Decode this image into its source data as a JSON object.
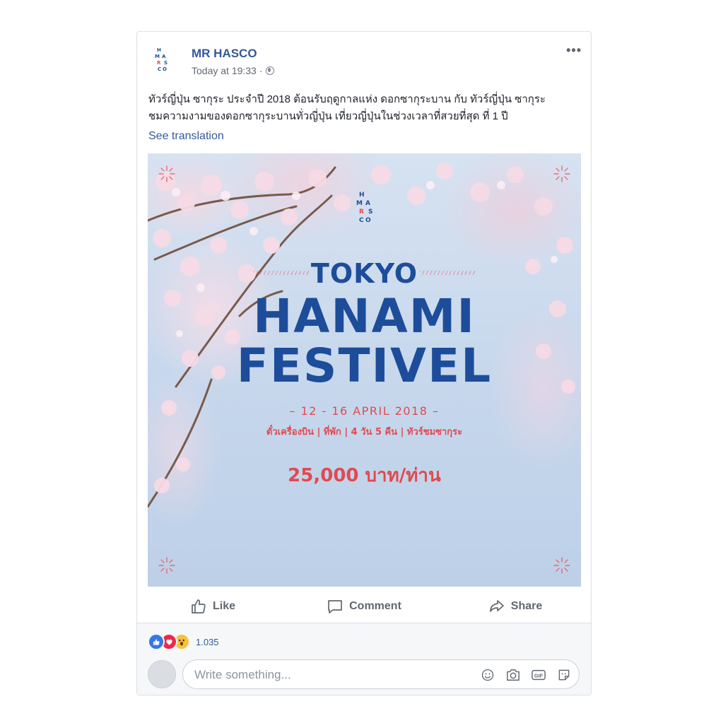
{
  "post": {
    "page_name": "MR HASCO",
    "timestamp": "Today at 19:33 ·",
    "text_line1": "ทัวร์ญี่ปุ่น ซากุระ ประจำปี 2018 ต้อนรับฤดูกาลแห่ง ดอกซากุระบาน กับ ทัวร์ญี่ปุ่น ซากุระ",
    "text_line2": "ชมความงามของดอกซากุระบานทั่วญี่ปุ่น เที่ยวญี่ปุ่นในช่วงเวลาที่สวยที่สุด ที่ 1 ปี",
    "see_translation": "See translation",
    "more_menu": "•••"
  },
  "logo": {
    "letters": [
      "H",
      "M",
      "A",
      "R",
      "S",
      "C",
      "O"
    ]
  },
  "image": {
    "tokyo": "TOKYO",
    "hanami": "HANAMI",
    "festivel": "FESTIVEL",
    "dates": "– 12 - 16 APRIL 2018 –",
    "details": "ตั๋วเครื่องบิน | ที่พัก | 4 วัน 5 คืน | ทัวร์ชมซากุระ",
    "price": "25,000 บาท/ท่าน",
    "colors": {
      "title_blue": "#1d4d9a",
      "accent_red": "#e04a50"
    }
  },
  "actions": {
    "like": "Like",
    "comment": "Comment",
    "share": "Share"
  },
  "reactions": {
    "count": "1.035",
    "types": [
      "like-icon",
      "love-icon",
      "wow-icon"
    ]
  },
  "comment_box": {
    "placeholder": "Write something...",
    "icons": [
      "emoji-icon",
      "camera-icon",
      "gif-icon",
      "sticker-icon"
    ]
  }
}
